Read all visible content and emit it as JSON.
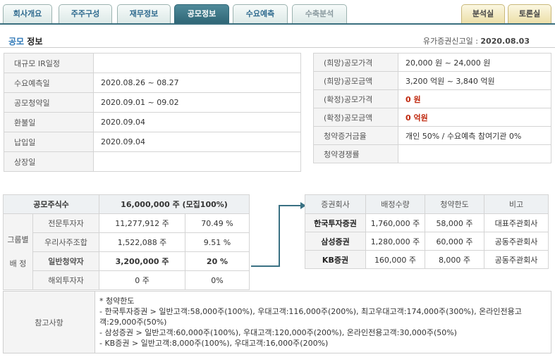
{
  "tabs": [
    {
      "label": "회사개요"
    },
    {
      "label": "주주구성"
    },
    {
      "label": "재무정보"
    },
    {
      "label": "공모정보"
    },
    {
      "label": "수요예측"
    },
    {
      "label": "수축분석"
    },
    {
      "label": "분석실"
    },
    {
      "label": "토론실"
    }
  ],
  "header": {
    "title_prefix": "공모",
    "title_suffix": "정보",
    "filed_label": "유가증권신고일 :",
    "filed_date": "2020.08.03"
  },
  "schedule": [
    {
      "label": "대규모 IR일정",
      "value": ""
    },
    {
      "label": "수요예측일",
      "value": "2020.08.26 ~ 08.27"
    },
    {
      "label": "공모청약일",
      "value": "2020.09.01 ~ 09.02"
    },
    {
      "label": "환불일",
      "value": "2020.09.04"
    },
    {
      "label": "납입일",
      "value": "2020.09.04"
    },
    {
      "label": "상장일",
      "value": ""
    }
  ],
  "pricing": [
    {
      "label": "(희망)공모가격",
      "value": "20,000 원 ~ 24,000 원"
    },
    {
      "label": "(희망)공모금액",
      "value": "3,200 억원   ~ 3,840 억원"
    },
    {
      "label": "(확정)공모가격",
      "value": "0 원"
    },
    {
      "label": "(확정)공모금액",
      "value": "0 억원"
    },
    {
      "label": "청약증거금율",
      "value": "개인 50% / 수요예측 참여기관 0%"
    },
    {
      "label": "청약경쟁률",
      "value": ""
    }
  ],
  "shares": {
    "total_label": "공모주식수",
    "total_value": "16,000,000  주 (모집100%)",
    "group_label_1": "그룹별",
    "group_label_2": "배  정",
    "rows": [
      {
        "label": "전문투자자",
        "qty": "11,277,912 주",
        "pct": "70.49 %"
      },
      {
        "label": "우리사주조합",
        "qty": "1,522,088 주",
        "pct": "9.51 %"
      },
      {
        "label": "일반청약자",
        "qty": "3,200,000  주",
        "pct": "20 %"
      },
      {
        "label": "해외투자자",
        "qty": "0 주",
        "pct": "0%"
      }
    ]
  },
  "underwriters": {
    "headers": [
      "증권회사",
      "배정수량",
      "청약한도",
      "비고"
    ],
    "rows": [
      {
        "company": "한국투자증권",
        "qty": "1,760,000 주",
        "limit": "58,000 주",
        "note": "대표주관회사"
      },
      {
        "company": "삼성증권",
        "qty": "1,280,000 주",
        "limit": "60,000 주",
        "note": "공동주관회사"
      },
      {
        "company": "KB증권",
        "qty": "160,000 주",
        "limit": "8,000 주",
        "note": "공동주관회사"
      }
    ]
  },
  "notes": {
    "label": "참고사항",
    "lines": [
      "* 청약한도",
      "- 한국투자증권 > 일반고객:58,000주(100%), 우대고객:116,000주(200%), 최고우대고객:174,000주(300%), 온라인전용고객:29,000주(50%)",
      "- 삼성증권 > 일반고객:60,000주(100%), 우대고객:120,000주(200%), 온라인전용고객:30,000주(50%)",
      "- KB증권 > 일반고객:8,000주(100%), 우대고객:16,000주(200%)"
    ]
  },
  "colors": {
    "accent": "#2f6676",
    "red_value": "#c0290f",
    "title_blue": "#2f78b7"
  }
}
